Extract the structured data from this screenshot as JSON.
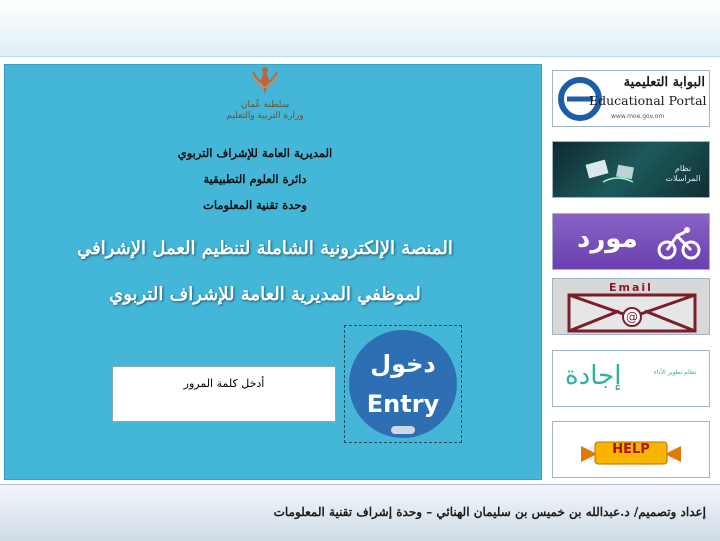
{
  "ministry": {
    "line1": "سلطنة عُمان",
    "line2": "وزارة التربية والتعليم"
  },
  "headings": {
    "directorate": "المديرية العامة للإشراف التربوي",
    "department": "دائرة العلوم التطبيقية",
    "unit": "وحدة تقنية المعلومات"
  },
  "title": {
    "line1": "المنصة الإلكترونية الشاملة لتنظيم العمل الإشرافي",
    "line2": "لموظفي المديرية العامة للإشراف التربوي"
  },
  "login": {
    "password_label": "أدخل كلمة المرور",
    "entry_ar": "دخول",
    "entry_en": "Entry"
  },
  "sidebar": {
    "portal_ar": "البوابة التعليمية",
    "portal_en": "Educational Portal",
    "portal_url": "www.moe.gov.om",
    "correspondence": "نظام المراسلات",
    "mawrid": "مورد",
    "email": "Email",
    "ijada": "إجادة",
    "ijada_sub": "نظام تطوير الأداء",
    "help": "HELP"
  },
  "footer": {
    "credit": "إعداد وتصميم/ د.عبدالله بن خميس بن سليمان الهنائي – وحدة إشراف تقنية المعلومات"
  },
  "colors": {
    "main_bg": "#44b6d8",
    "entry_button": "#2e6fb4"
  }
}
